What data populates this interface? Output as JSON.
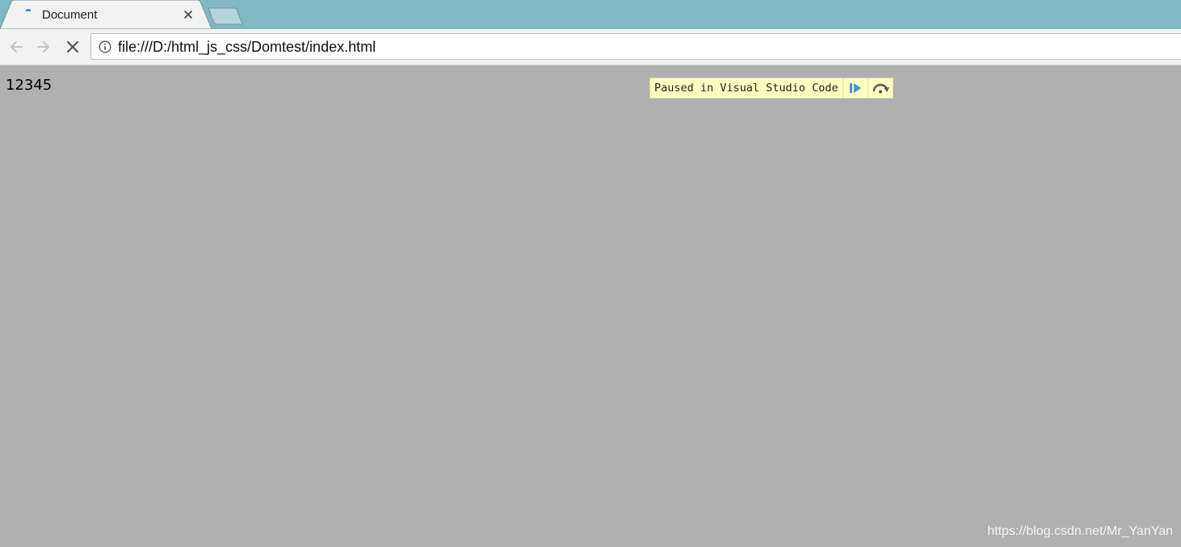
{
  "tab": {
    "title": "Document",
    "close_icon": "close-icon",
    "loading_icon": "loading-spinner-icon"
  },
  "toolbar": {
    "back_icon": "arrow-left-icon",
    "forward_icon": "arrow-right-icon",
    "stop_icon": "stop-x-icon",
    "info_icon": "info-circle-icon",
    "url": "file:///D:/html_js_css/Domtest/index.html"
  },
  "page": {
    "content_text": "12345"
  },
  "debugger": {
    "message": "Paused in Visual Studio Code",
    "resume_icon": "resume-play-icon",
    "step_over_icon": "step-over-icon",
    "accent_color": "#4a90d9"
  },
  "watermark": {
    "text": "https://blog.csdn.net/Mr_YanYan"
  },
  "colors": {
    "tabstrip": "#7fb8c1",
    "page_overlay": "#b0b0b0",
    "debug_bar": "#ffffc0"
  }
}
